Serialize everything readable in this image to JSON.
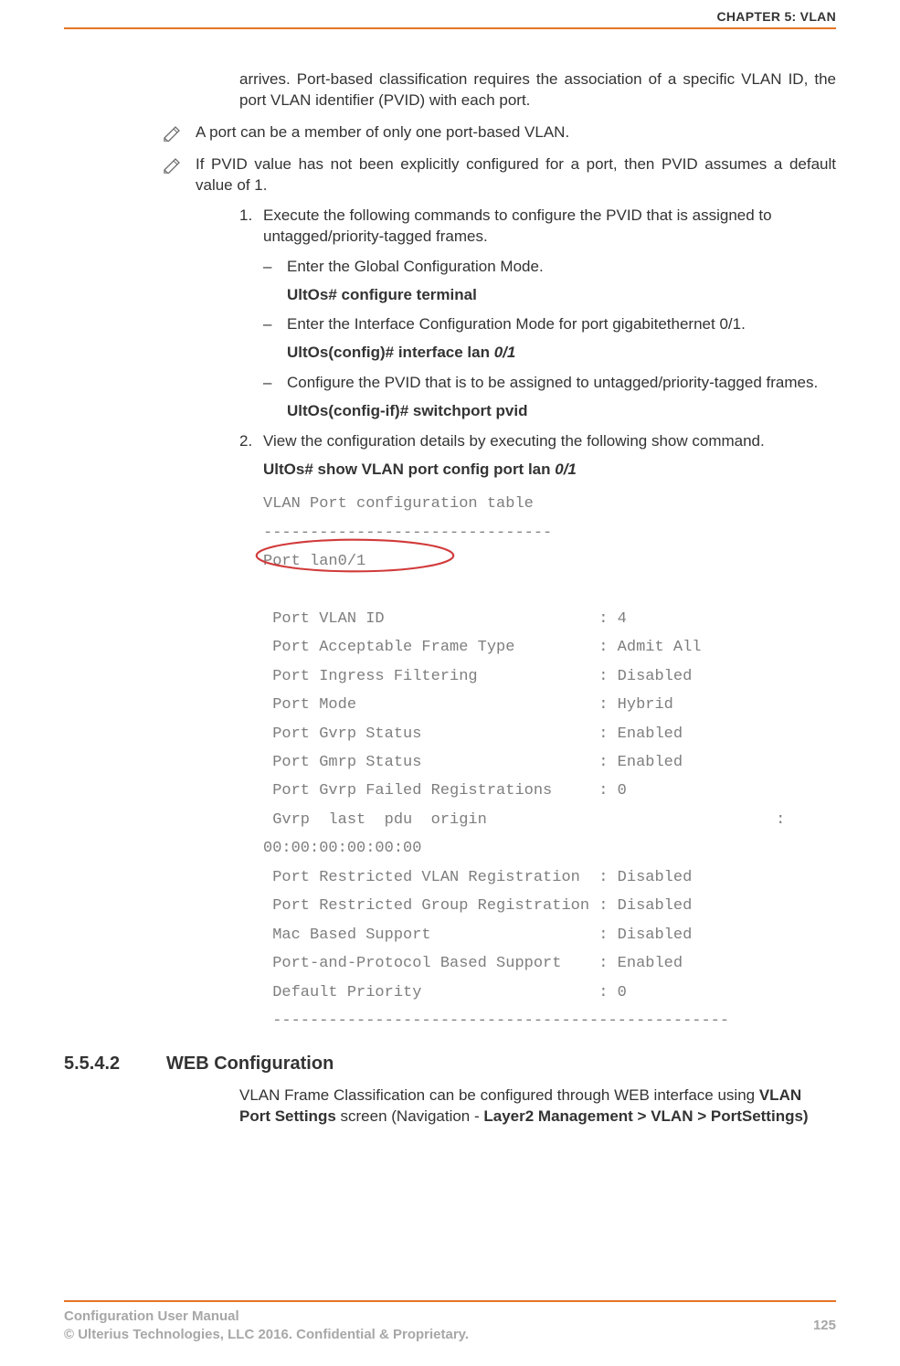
{
  "header": {
    "chapter": "CHAPTER 5: VLAN"
  },
  "body": {
    "intro_continuation": "arrives. Port-based classification requires the association of a specific VLAN ID, the port VLAN identifier (PVID) with each port.",
    "note1": "A port can be a member of only one port-based VLAN.",
    "note2": "If PVID value has not been explicitly configured for a port, then PVID assumes a default value of 1.",
    "step1_num": "1.",
    "step1_text": "Execute the following commands to configure the PVID that is assigned to untagged/priority-tagged frames.",
    "dash1": "–",
    "dash1_text": "Enter the Global Configuration Mode.",
    "cmd1": "UltOs# configure terminal",
    "dash2_text": "Enter the Interface Configuration Mode for port gigabitethernet 0/1.",
    "cmd2_prefix": "UltOs(config)# interface lan ",
    "cmd2_arg": "0/1",
    "dash3_text": "Configure the PVID that is to be assigned to untagged/priority-tagged frames.",
    "cmd3": "UltOs(config-if)# switchport pvid",
    "step2_num": "2.",
    "step2_text": "View the configuration details by executing the following show command.",
    "showcmd_prefix": "UltOs# show VLAN port config port lan ",
    "showcmd_arg": "0/1"
  },
  "terminal": {
    "title": "VLAN Port configuration table",
    "rule1": "-------------------------------",
    "port_line": "Port lan0/1",
    "rows": [
      " Port VLAN ID                       : 4",
      " Port Acceptable Frame Type         : Admit All",
      " Port Ingress Filtering             : Disabled",
      " Port Mode                          : Hybrid",
      " Port Gvrp Status                   : Enabled",
      " Port Gmrp Status                   : Enabled",
      " Port Gvrp Failed Registrations     : 0",
      " Gvrp  last  pdu  origin                               :\n00:00:00:00:00:00",
      " Port Restricted VLAN Registration  : Disabled",
      " Port Restricted Group Registration : Disabled",
      " Mac Based Support                  : Disabled",
      " Port-and-Protocol Based Support    : Enabled",
      " Default Priority                   : 0"
    ],
    "rule2": " -------------------------------------------------"
  },
  "section": {
    "number": "5.5.4.2",
    "title": "WEB Configuration",
    "para_plain1": "VLAN Frame Classification can be configured through WEB interface using ",
    "para_bold1": "VLAN Port Settings",
    "para_plain2": " screen (Navigation - ",
    "para_bold2": "Layer2 Management > VLAN > PortSettings)"
  },
  "footer": {
    "line1": "Configuration User Manual",
    "line2": "© Ulterius Technologies, LLC 2016. Confidential & Proprietary.",
    "page": "125"
  }
}
